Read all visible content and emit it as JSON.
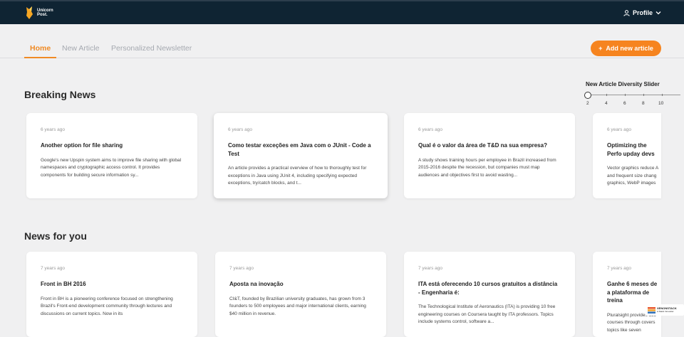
{
  "brand": {
    "name_line1": "Unicorn",
    "name_line2": "Post."
  },
  "header": {
    "profile_label": "Profile"
  },
  "nav": {
    "tabs": [
      "Home",
      "New Article",
      "Personalized Newsletter"
    ],
    "add_button": "Add new article"
  },
  "slider": {
    "title": "New Article Diversity Slider",
    "value": 2,
    "min": 2,
    "max": 10,
    "ticks": [
      "2",
      "4",
      "6",
      "8",
      "10"
    ]
  },
  "sections": {
    "breaking": {
      "title": "Breaking News",
      "cards": [
        {
          "time": "6 years ago",
          "title": "Another option for file sharing",
          "desc": "Google's new Upspin system aims to improve file sharing with global namespaces and cryptographic access control. It provides components for building secure information sy..."
        },
        {
          "time": "6 years ago",
          "title": "Como testar exceções em Java com o JUnit - Code a Test",
          "desc": "An article provides a practical overview of how to thoroughly test for exceptions in Java using JUnit 4, including specifying expected exceptions, try/catch blocks, and t..."
        },
        {
          "time": "6 years ago",
          "title": "Qual é o valor da área de T&D na sua empresa?",
          "desc": "A study shows training hours per employee in Brazil increased from 2015-2016 despite the recession, but companies must map audiences and objectives first to avoid wasting..."
        },
        {
          "time": "6 years ago",
          "title": "Optimizing the Perfo upday devs",
          "desc": "Vector graphics reduce A and frequent size chang graphics, WebP images"
        }
      ]
    },
    "foryou": {
      "title": "News for you",
      "cards": [
        {
          "time": "7 years ago",
          "title": "Front in BH 2016",
          "desc": "Front in BH is a pioneering conference focused on strengthening Brazil's Front-end development community through lectures and discussions on current topics. Now in its"
        },
        {
          "time": "7 years ago",
          "title": "Aposta na inovação",
          "desc": "CI&T, founded by Brazilian university graduates, has grown from 3 founders to 500 employees and major international clients, earning $40 million in revenue."
        },
        {
          "time": "7 years ago",
          "title": "ITA está oferecendo 10 cursos gratuitos a distância - Engenharia é:",
          "desc": "The Technological Institute of Aeronautics (ITA) is providing 10 free engineering courses on Coursera taught by ITA professors. Topics include systems control, software a..."
        },
        {
          "time": "7 years ago",
          "title": "Ganhe 6 meses de a plataforma de treina",
          "desc": "Pluralsight provides acc courses through covers topics like seven"
        }
      ]
    }
  },
  "watermark": {
    "text_line1": "XENONSTACK",
    "text_line2": "A Stack Innovator"
  },
  "colors": {
    "header": "#0f2433",
    "accent": "#f6841f",
    "background": "#f0f0f1"
  }
}
